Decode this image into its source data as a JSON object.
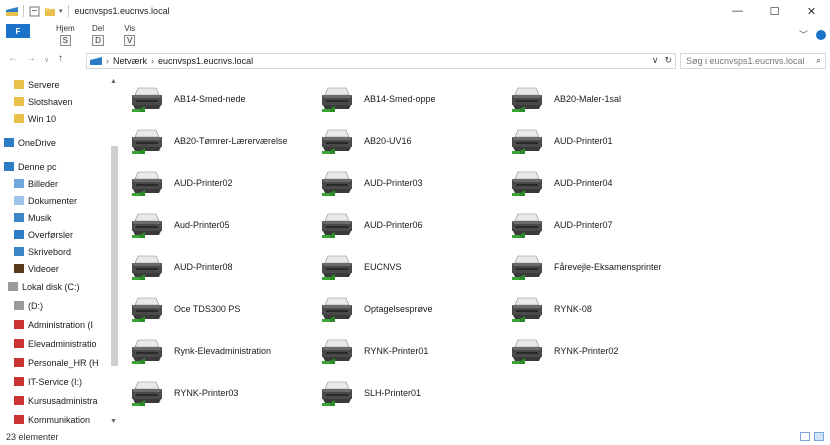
{
  "window": {
    "title": "eucnvsps1.eucnvs.local"
  },
  "ribbon": {
    "file_key": "F",
    "tabs": [
      {
        "label": "Hjem",
        "keytip": "S"
      },
      {
        "label": "Del",
        "keytip": "D"
      },
      {
        "label": "Vis",
        "keytip": "V"
      }
    ]
  },
  "address": {
    "segments": [
      "Netværk",
      "eucnvsps1.eucnvs.local"
    ],
    "search_placeholder": "Søg i eucnvsps1.eucnvs.local"
  },
  "nav": [
    {
      "label": "Servere",
      "icon": "folder-icon"
    },
    {
      "label": "Slotshaven",
      "icon": "folder-icon"
    },
    {
      "label": "Win 10",
      "icon": "folder-icon"
    },
    {
      "label": "OneDrive",
      "icon": "cloud-icon"
    },
    {
      "label": "Denne pc",
      "icon": "computer-icon"
    },
    {
      "label": "Billeder",
      "icon": "pictures-icon"
    },
    {
      "label": "Dokumenter",
      "icon": "documents-icon"
    },
    {
      "label": "Musik",
      "icon": "music-icon"
    },
    {
      "label": "Overførsler",
      "icon": "downloads-icon"
    },
    {
      "label": "Skrivebord",
      "icon": "desktop-icon"
    },
    {
      "label": "Videoer",
      "icon": "videos-icon"
    },
    {
      "label": "Lokal disk (C:)",
      "icon": "drive-icon"
    },
    {
      "label": "(D:)",
      "icon": "drive-icon"
    },
    {
      "label": "Administration (I",
      "icon": "network-drive-icon"
    },
    {
      "label": "Elevadministratio",
      "icon": "network-drive-icon"
    },
    {
      "label": "Personale_HR (H",
      "icon": "network-drive-icon"
    },
    {
      "label": "IT-Service (I:)",
      "icon": "network-drive-icon"
    },
    {
      "label": "Kursusadministra",
      "icon": "network-drive-icon"
    },
    {
      "label": "Kommunikation",
      "icon": "network-drive-icon"
    }
  ],
  "items": [
    "AB14-Smed-nede",
    "AB14-Smed-oppe",
    "AB20-Maler-1sal",
    "AB20-Tømrer-Lærerværelse",
    "AB20-UV16",
    "AUD-Printer01",
    "AUD-Printer02",
    "AUD-Printer03",
    "AUD-Printer04",
    "Aud-Printer05",
    "AUD-Printer06",
    "AUD-Printer07",
    "AUD-Printer08",
    "EUCNVS",
    "Fårevejle-Eksamensprinter",
    "Oce TDS300 PS",
    "Optagelsesprøve",
    "RYNK-08",
    "Rynk-Elevadministration",
    "RYNK-Printer01",
    "RYNK-Printer02",
    "RYNK-Printer03",
    "SLH-Printer01"
  ],
  "status": {
    "count": "23 elementer"
  }
}
